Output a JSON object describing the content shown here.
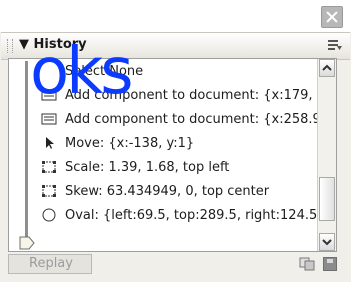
{
  "panel": {
    "title": "History"
  },
  "history_items": [
    {
      "label": "Select None",
      "icon": "select-none-icon"
    },
    {
      "label": "Add component to document: {x:179, y:",
      "icon": "document-icon"
    },
    {
      "label": "Add component to document: {x:258.9, ·",
      "icon": "document-icon"
    },
    {
      "label": "Move: {x:-138, y:1}",
      "icon": "arrow-pointer-icon"
    },
    {
      "label": "Scale: 1.39, 1.68, top left",
      "icon": "transform-box-icon"
    },
    {
      "label": "Skew: 63.434949, 0, top center",
      "icon": "transform-box-icon"
    },
    {
      "label": "Oval: {left:69.5, top:289.5, right:124.5,",
      "icon": "oval-icon"
    }
  ],
  "footer": {
    "replay_label": "Replay"
  },
  "overlay": {
    "text": "oks",
    "color": "#0a3bff"
  }
}
